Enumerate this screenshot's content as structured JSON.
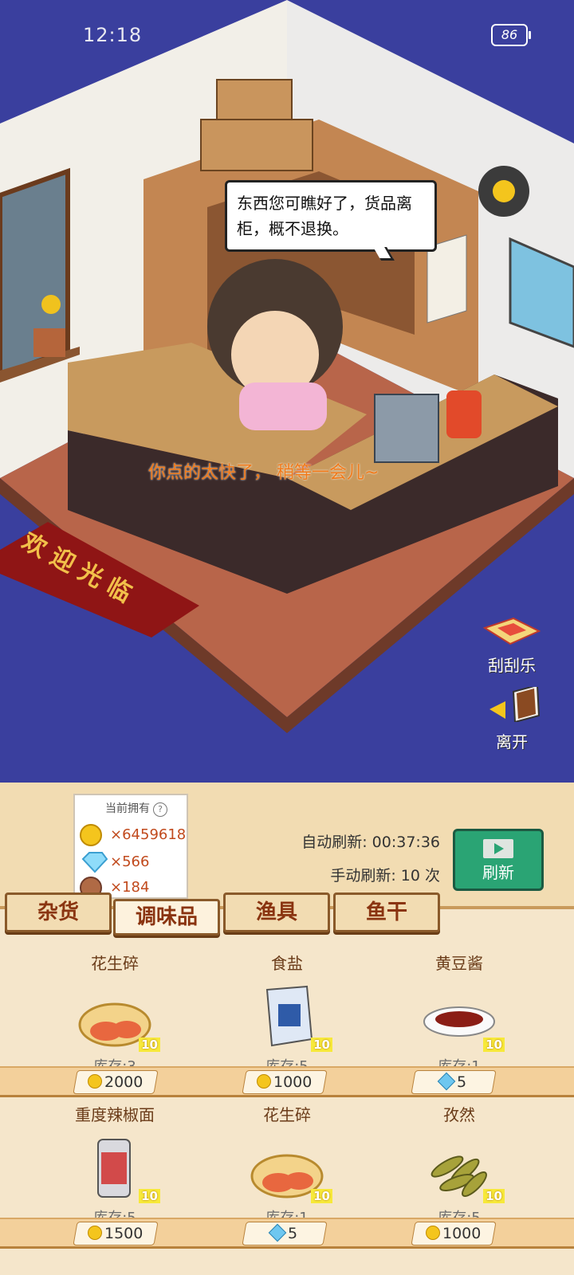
{
  "status": {
    "time": "12:18",
    "battery": "86"
  },
  "scene": {
    "speech": "东西您可瞧好了，货品离柜，概不退换。",
    "toast": "你点的太快了， 稍等一会儿~",
    "mat_text": "欢迎光临",
    "side_buttons": {
      "lottery": "刮刮乐",
      "leave": "离开"
    }
  },
  "wallet": {
    "title": "当前拥有",
    "help": "?",
    "coins": "6459618",
    "gems": "566",
    "tokens": "184",
    "multiplier": "×"
  },
  "refresh": {
    "auto": "自动刷新: 00:37:36",
    "manual": "手动刷新: 10 次",
    "button": "刷新"
  },
  "tabs": [
    "杂货",
    "调味品",
    "渔具",
    "鱼干"
  ],
  "active_tab": 1,
  "items": [
    {
      "name": "花生碎",
      "qty": "10",
      "stock": "库存:3",
      "price": "2000",
      "currency": "coin",
      "icon": "peanut-icon"
    },
    {
      "name": "食盐",
      "qty": "10",
      "stock": "库存:5",
      "price": "1000",
      "currency": "coin",
      "icon": "salt-bag-icon"
    },
    {
      "name": "黄豆酱",
      "qty": "10",
      "stock": "库存:1",
      "price": "5",
      "currency": "gem",
      "icon": "sauce-plate-icon"
    },
    {
      "name": "重度辣椒面",
      "qty": "10",
      "stock": "库存:5",
      "price": "1500",
      "currency": "coin",
      "icon": "chili-can-icon"
    },
    {
      "name": "花生碎",
      "qty": "10",
      "stock": "库存:1",
      "price": "5",
      "currency": "gem",
      "icon": "peanut-icon"
    },
    {
      "name": "孜然",
      "qty": "10",
      "stock": "库存:5",
      "price": "1000",
      "currency": "coin",
      "icon": "cumin-icon"
    }
  ],
  "colors": {
    "accent": "#2aa474",
    "text_brown": "#8a3410",
    "toast": "#f07a1a",
    "floor": "#b8654a",
    "bg": "#3a3f9e"
  }
}
